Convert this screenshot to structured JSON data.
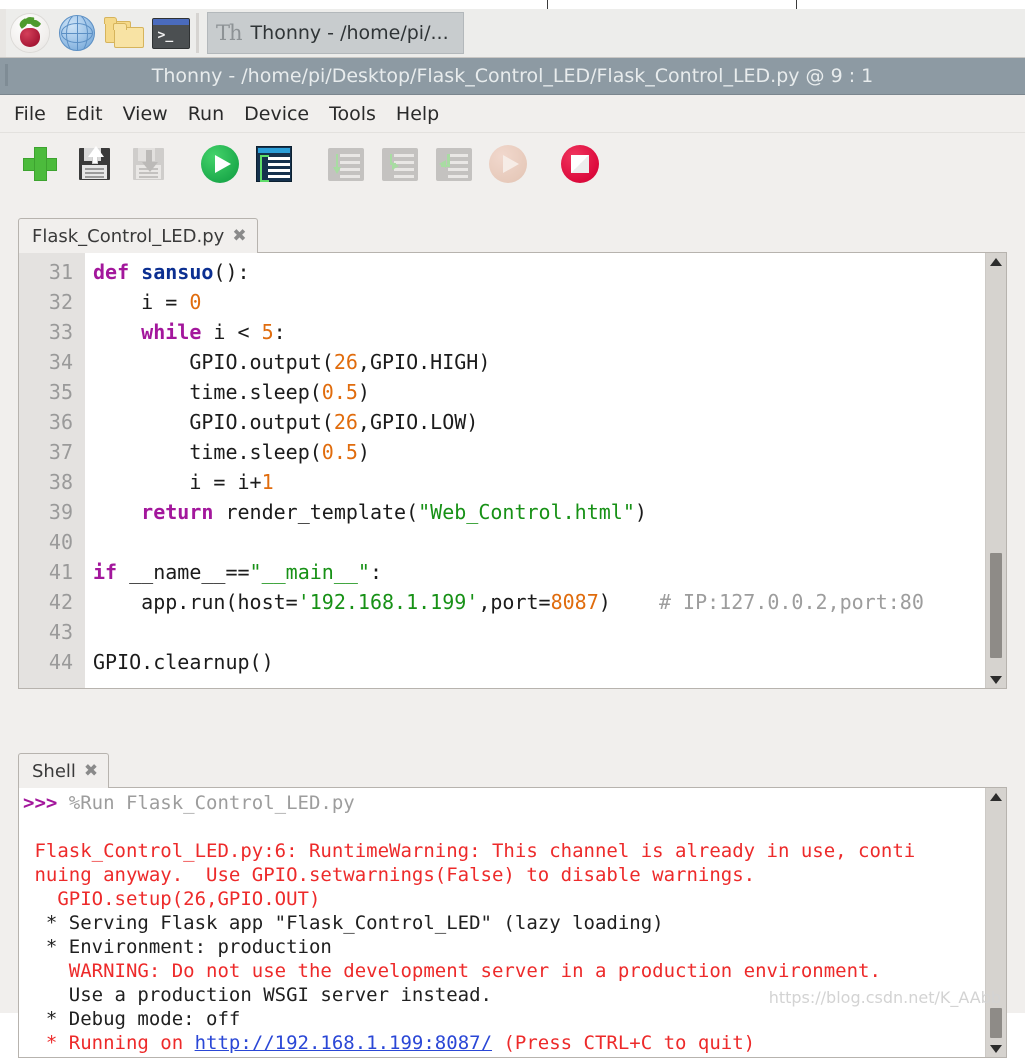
{
  "taskbar": {
    "icons": [
      {
        "name": "raspberry-menu-icon",
        "label": "Raspberry Pi Menu"
      },
      {
        "name": "web-browser-icon",
        "label": "Web Browser"
      },
      {
        "name": "file-manager-icon",
        "label": "File Manager"
      },
      {
        "name": "terminal-icon",
        "label": "Terminal"
      }
    ],
    "window_button": {
      "icon": "thonny-icon",
      "icon_text": "Th",
      "label": "Thonny  -  /home/pi/..."
    }
  },
  "window": {
    "title": "Thonny  -  /home/pi/Desktop/Flask_Control_LED/Flask_Control_LED.py  @  9 : 1"
  },
  "menu": {
    "items": [
      {
        "name": "menu-file",
        "label": "File"
      },
      {
        "name": "menu-edit",
        "label": "Edit"
      },
      {
        "name": "menu-view",
        "label": "View"
      },
      {
        "name": "menu-run",
        "label": "Run"
      },
      {
        "name": "menu-device",
        "label": "Device"
      },
      {
        "name": "menu-tools",
        "label": "Tools"
      },
      {
        "name": "menu-help",
        "label": "Help"
      }
    ]
  },
  "toolbar": {
    "buttons": [
      {
        "name": "new-file-button",
        "icon": "plus-icon",
        "enabled": true
      },
      {
        "name": "save-button",
        "icon": "floppy-save-icon",
        "enabled": true
      },
      {
        "name": "load-button",
        "icon": "floppy-load-icon",
        "enabled": false
      },
      {
        "name": "run-button",
        "icon": "play-circle-icon",
        "enabled": true
      },
      {
        "name": "debug-button",
        "icon": "debug-icon",
        "enabled": true
      },
      {
        "name": "step-over-button",
        "icon": "step-over-icon",
        "enabled": false
      },
      {
        "name": "step-into-button",
        "icon": "step-into-icon",
        "enabled": false
      },
      {
        "name": "step-out-button",
        "icon": "step-out-icon",
        "enabled": false
      },
      {
        "name": "resume-button",
        "icon": "resume-icon",
        "enabled": false
      },
      {
        "name": "stop-button",
        "icon": "stop-icon",
        "enabled": true
      }
    ]
  },
  "editor": {
    "tab": {
      "label": "Flask_Control_LED.py",
      "close_glyph": "✖"
    },
    "first_line_number": 31,
    "lines": [
      {
        "no": "31",
        "tokens": [
          {
            "t": "def ",
            "c": "kw"
          },
          {
            "t": "sansuo",
            "c": "fn"
          },
          {
            "t": "():",
            "c": ""
          }
        ]
      },
      {
        "no": "32",
        "tokens": [
          {
            "t": "    i = ",
            "c": ""
          },
          {
            "t": "0",
            "c": "num"
          }
        ]
      },
      {
        "no": "33",
        "tokens": [
          {
            "t": "    ",
            "c": ""
          },
          {
            "t": "while",
            "c": "kw"
          },
          {
            "t": " i < ",
            "c": ""
          },
          {
            "t": "5",
            "c": "num"
          },
          {
            "t": ":",
            "c": ""
          }
        ]
      },
      {
        "no": "34",
        "tokens": [
          {
            "t": "        GPIO.output(",
            "c": ""
          },
          {
            "t": "26",
            "c": "num"
          },
          {
            "t": ",GPIO.HIGH)",
            "c": ""
          }
        ]
      },
      {
        "no": "35",
        "tokens": [
          {
            "t": "        time.sleep(",
            "c": ""
          },
          {
            "t": "0.5",
            "c": "num"
          },
          {
            "t": ")",
            "c": ""
          }
        ]
      },
      {
        "no": "36",
        "tokens": [
          {
            "t": "        GPIO.output(",
            "c": ""
          },
          {
            "t": "26",
            "c": "num"
          },
          {
            "t": ",GPIO.LOW)",
            "c": ""
          }
        ]
      },
      {
        "no": "37",
        "tokens": [
          {
            "t": "        time.sleep(",
            "c": ""
          },
          {
            "t": "0.5",
            "c": "num"
          },
          {
            "t": ")",
            "c": ""
          }
        ]
      },
      {
        "no": "38",
        "tokens": [
          {
            "t": "        i = i+",
            "c": ""
          },
          {
            "t": "1",
            "c": "num"
          }
        ]
      },
      {
        "no": "39",
        "tokens": [
          {
            "t": "    ",
            "c": ""
          },
          {
            "t": "return",
            "c": "kw"
          },
          {
            "t": " render_template(",
            "c": ""
          },
          {
            "t": "\"Web_Control.html\"",
            "c": "str"
          },
          {
            "t": ")",
            "c": ""
          }
        ]
      },
      {
        "no": "40",
        "tokens": []
      },
      {
        "no": "41",
        "tokens": [
          {
            "t": "if",
            "c": "kw"
          },
          {
            "t": " __name__==",
            "c": ""
          },
          {
            "t": "\"__main__\"",
            "c": "str"
          },
          {
            "t": ":",
            "c": ""
          }
        ]
      },
      {
        "no": "42",
        "tokens": [
          {
            "t": "    app.run(host=",
            "c": ""
          },
          {
            "t": "'192.168.1.199'",
            "c": "str"
          },
          {
            "t": ",port=",
            "c": ""
          },
          {
            "t": "8087",
            "c": "num"
          },
          {
            "t": ")    ",
            "c": ""
          },
          {
            "t": "# IP:127.0.0.2,port:80",
            "c": "cmt"
          }
        ]
      },
      {
        "no": "43",
        "tokens": []
      },
      {
        "no": "44",
        "tokens": [
          {
            "t": "GPIO.clearnup()",
            "c": ""
          }
        ]
      }
    ]
  },
  "shell": {
    "tab": {
      "label": "Shell",
      "close_glyph": "✖"
    },
    "lines": [
      {
        "tokens": [
          {
            "t": ">>> ",
            "c": "prompt"
          },
          {
            "t": "%Run Flask_Control_LED.py",
            "c": "dim"
          }
        ]
      },
      {
        "tokens": []
      },
      {
        "tokens": [
          {
            "t": " Flask_Control_LED.py:6: RuntimeWarning: This channel is already in use, conti",
            "c": "err"
          }
        ]
      },
      {
        "tokens": [
          {
            "t": " nuing anyway.  Use GPIO.setwarnings(False) to disable warnings.",
            "c": "err"
          }
        ]
      },
      {
        "tokens": [
          {
            "t": "   GPIO.setup(26,GPIO.OUT)",
            "c": "err"
          }
        ]
      },
      {
        "tokens": [
          {
            "t": "  * Serving Flask app \"Flask_Control_LED\" (lazy loading)",
            "c": "blk"
          }
        ]
      },
      {
        "tokens": [
          {
            "t": "  * Environment: production",
            "c": "blk"
          }
        ]
      },
      {
        "tokens": [
          {
            "t": "    WARNING: Do not use the development server in a production environment.",
            "c": "err"
          }
        ]
      },
      {
        "tokens": [
          {
            "t": "    Use a production WSGI server instead.",
            "c": "blk"
          }
        ]
      },
      {
        "tokens": [
          {
            "t": "  * Debug mode: off",
            "c": "blk"
          }
        ]
      },
      {
        "tokens": [
          {
            "t": "  * Running on ",
            "c": "err"
          },
          {
            "t": "http://192.168.1.199:8087/",
            "c": "lnk"
          },
          {
            "t": " (Press CTRL+C to quit)",
            "c": "err"
          }
        ]
      }
    ]
  },
  "watermark": {
    "text": "https://blog.csdn.net/K_AAbb"
  },
  "colors": {
    "titlebar_bg": "#8d9aa3",
    "window_bg": "#f1efed",
    "gutter_bg": "#e4e2e0",
    "keyword": "#a3179c",
    "function": "#0b2f91",
    "number": "#e06c0d",
    "string": "#179116",
    "comment": "#9d9d9d",
    "error": "#ed2a2a",
    "link": "#2a47d6",
    "accent_run": "#1dab4c",
    "accent_stop": "#dc0a3c"
  }
}
